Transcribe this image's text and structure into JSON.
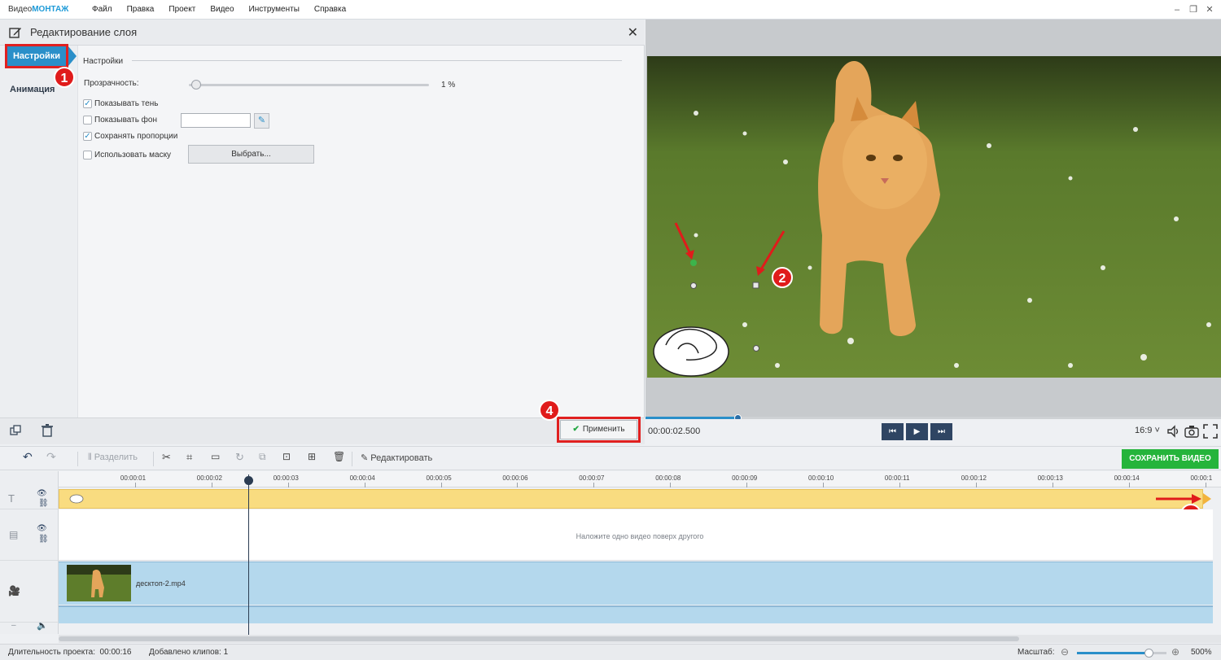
{
  "app": {
    "logo_prefix": "Видео",
    "logo_brand": "МОНТАЖ",
    "menu": [
      "Файл",
      "Правка",
      "Проект",
      "Видео",
      "Инструменты",
      "Справка"
    ]
  },
  "panel": {
    "title": "Редактирование слоя",
    "tabs": {
      "settings": "Настройки",
      "animation": "Анимация"
    },
    "section_title": "Настройки",
    "opacity_label": "Прозрачность:",
    "opacity_value_text": "1 %",
    "opacity_value": 1,
    "show_shadow_label": "Показывать тень",
    "show_shadow_checked": true,
    "show_background_label": "Показывать фон",
    "show_background_checked": false,
    "keep_ratio_label": "Сохранять пропорции",
    "keep_ratio_checked": true,
    "use_mask_label": "Использовать маску",
    "use_mask_checked": false,
    "choose_button": "Выбрать...",
    "apply_button": "Применить"
  },
  "badges": [
    "1",
    "2",
    "3",
    "4"
  ],
  "preview": {
    "timecode": "00:00:02.500",
    "progress": 0.16,
    "aspect_ratio": "16:9"
  },
  "toolbar": {
    "split_label": "Разделить",
    "edit_label": "Редактировать",
    "save_video": "СОХРАНИТЬ ВИДЕО"
  },
  "timeline": {
    "ticks": [
      "00:00:01",
      "00:00:02",
      "00:00:03",
      "00:00:04",
      "00:00:05",
      "00:00:06",
      "00:00:07",
      "00:00:08",
      "00:00:09",
      "00:00:10",
      "00:00:11",
      "00:00:12",
      "00:00:13",
      "00:00:14",
      "00:00:1"
    ],
    "overlay_hint": "Наложите одно видео поверх другого",
    "clip_name": "десктоп-2.mp4",
    "playhead_time_sec": 2.5
  },
  "status": {
    "duration_label": "Длительность проекта:",
    "duration_value": "00:00:16",
    "clips_label": "Добавлено клипов:",
    "clips_value": "1",
    "zoom_label": "Масштаб:",
    "zoom_value": "500%",
    "zoom_level": 0.8
  },
  "colors": {
    "accent": "#2a8fc9",
    "highlight": "#e02020",
    "save_green": "#25b43b",
    "title_track": "#f9dc80",
    "video_track": "#b4d8ed"
  }
}
